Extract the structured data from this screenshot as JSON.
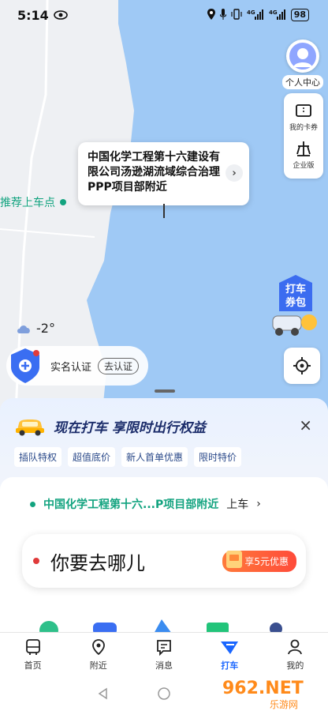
{
  "status_bar": {
    "time": "5:14",
    "battery": "98"
  },
  "profile": {
    "label": "个人中心"
  },
  "side_panel": {
    "card_label": "我的卡券",
    "enterprise_label": "企业版"
  },
  "popup": {
    "address": "中国化学工程第十六建设有限公司汤逊湖流域综合治理PPP项目部附近"
  },
  "pickup_marker": {
    "label": "推荐上车点"
  },
  "promo_float": {
    "line1": "打车",
    "line2": "券包"
  },
  "weather": {
    "temperature": "-2°"
  },
  "verify": {
    "label": "实名认证",
    "button": "去认证"
  },
  "banner": {
    "title": "现在打车 享限时出行权益"
  },
  "tags": [
    "插队特权",
    "超值底价",
    "新人首单优惠",
    "限时特价"
  ],
  "pickup_row": {
    "text": "中国化学工程第十六...P项目部附近",
    "suffix": "上车"
  },
  "destination": {
    "placeholder": "你要去哪儿",
    "discount": "享5元优惠"
  },
  "nav": [
    {
      "label": "首页"
    },
    {
      "label": "附近"
    },
    {
      "label": "消息"
    },
    {
      "label": "打车"
    },
    {
      "label": "我的"
    }
  ],
  "watermark": {
    "text": "962.NET",
    "sub": "乐游网"
  },
  "colors": {
    "water": "#9fc9f5",
    "accent": "#1a66ff",
    "green": "#12a37f"
  }
}
